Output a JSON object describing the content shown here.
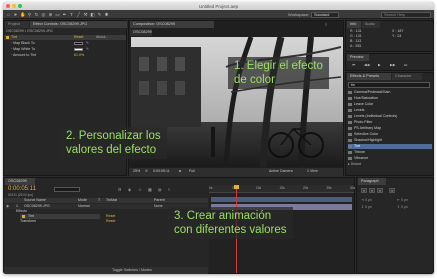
{
  "window": {
    "title": "Untitled Project.aep"
  },
  "toolbar": {
    "workspace_label": "Workspace:",
    "workspace_value": "Standard",
    "search_placeholder": "Search Help"
  },
  "effect_controls": {
    "tab_project": "Project",
    "tab_label": "Effect Controls: OSC08299.JPG",
    "breadcrumb": "OSC08299 • OSC08299.JPG",
    "effect_name": "Tint",
    "reset_label": "Reset",
    "about_label": "About...",
    "params": [
      {
        "label": "Map Black To"
      },
      {
        "label": "Map White To"
      },
      {
        "label": "Amount to Tint",
        "value": "61.0%"
      }
    ]
  },
  "composition": {
    "tab_label": "Composition: OSC08299",
    "layer_tab": "OSC08299",
    "zoom": "25%",
    "timecode": "0:00:05:11",
    "resolution": "Full",
    "camera": "Active Camera",
    "view": "1 View"
  },
  "overlays": {
    "step1": [
      "1. Elegir el efecto",
      "de color"
    ],
    "step2": [
      "2. Personalizar los",
      "valores del efecto"
    ],
    "step3": [
      "3. Crear animación",
      "con diferentes valores"
    ]
  },
  "info": {
    "tabs": [
      "Info",
      "Audio"
    ],
    "lines": [
      "R : 131",
      "G : 131",
      "B : 113",
      "A : 255",
      "X : 187",
      "Y : 24"
    ]
  },
  "preview": {
    "tab": "Preview"
  },
  "effects_presets": {
    "tabs": [
      "Effects & Presets",
      "Character"
    ],
    "search_value": "tin",
    "items": [
      "Gamma/Pedestal/Gain",
      "Hue/Saturation",
      "Leave Color",
      "Levels",
      "Levels (Individual Controls)",
      "Photo Filter",
      "PS Arbitrary Map",
      "Selective Color",
      "Shadow/Highlight",
      "Tint",
      "Tritone",
      "Vibrance"
    ],
    "selected_index": 9,
    "section_label": "Distort"
  },
  "paragraph": {
    "tab": "Paragraph"
  },
  "timeline": {
    "tab_label": "OSC08299",
    "timecode": "0:00:05:11",
    "subcode": "00131 (25.00 fps)",
    "columns": [
      "Source Name",
      "Mode",
      "T",
      "TrkMat",
      "Parent"
    ],
    "layer": {
      "index": "1",
      "name": "OSC08299.JPG",
      "mode": "Normal",
      "parent": "None"
    },
    "props": [
      {
        "label": "Effects"
      },
      {
        "label": "Tint",
        "value": "Reset"
      },
      {
        "label": "Transform",
        "value": "Reset"
      }
    ],
    "footer": "Toggle Switches / Modes",
    "ruler": [
      "0s",
      "05s",
      "10s",
      "15s",
      "20s",
      "25s",
      "30s"
    ],
    "playhead_position_s": 5.4,
    "duration_s": 30
  },
  "colors": {
    "overlay_text": "#9be060",
    "accent_yellow": "#e8b83a",
    "playhead": "#d23a3a",
    "selected_effect": "#4f6d99"
  }
}
